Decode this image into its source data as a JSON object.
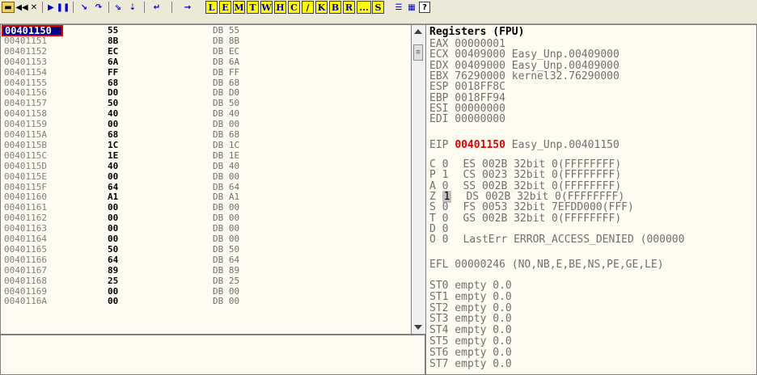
{
  "toolbar": {
    "letters": [
      "L",
      "E",
      "M",
      "T",
      "W",
      "H",
      "C",
      "/",
      "K",
      "B",
      "R",
      "...",
      "S"
    ],
    "help": "?"
  },
  "dump": {
    "selected_address": "00401150",
    "rows": [
      {
        "addr": "00401150",
        "hex": "55",
        "dis": "DB 55"
      },
      {
        "addr": "00401151",
        "hex": "8B",
        "dis": "DB 8B"
      },
      {
        "addr": "00401152",
        "hex": "EC",
        "dis": "DB EC"
      },
      {
        "addr": "00401153",
        "hex": "6A",
        "dis": "DB 6A"
      },
      {
        "addr": "00401154",
        "hex": "FF",
        "dis": "DB FF"
      },
      {
        "addr": "00401155",
        "hex": "68",
        "dis": "DB 68"
      },
      {
        "addr": "00401156",
        "hex": "D0",
        "dis": "DB D0"
      },
      {
        "addr": "00401157",
        "hex": "50",
        "dis": "DB 50"
      },
      {
        "addr": "00401158",
        "hex": "40",
        "dis": "DB 40"
      },
      {
        "addr": "00401159",
        "hex": "00",
        "dis": "DB 00"
      },
      {
        "addr": "0040115A",
        "hex": "68",
        "dis": "DB 68"
      },
      {
        "addr": "0040115B",
        "hex": "1C",
        "dis": "DB 1C"
      },
      {
        "addr": "0040115C",
        "hex": "1E",
        "dis": "DB 1E"
      },
      {
        "addr": "0040115D",
        "hex": "40",
        "dis": "DB 40"
      },
      {
        "addr": "0040115E",
        "hex": "00",
        "dis": "DB 00"
      },
      {
        "addr": "0040115F",
        "hex": "64",
        "dis": "DB 64"
      },
      {
        "addr": "00401160",
        "hex": "A1",
        "dis": "DB A1"
      },
      {
        "addr": "00401161",
        "hex": "00",
        "dis": "DB 00"
      },
      {
        "addr": "00401162",
        "hex": "00",
        "dis": "DB 00"
      },
      {
        "addr": "00401163",
        "hex": "00",
        "dis": "DB 00"
      },
      {
        "addr": "00401164",
        "hex": "00",
        "dis": "DB 00"
      },
      {
        "addr": "00401165",
        "hex": "50",
        "dis": "DB 50"
      },
      {
        "addr": "00401166",
        "hex": "64",
        "dis": "DB 64"
      },
      {
        "addr": "00401167",
        "hex": "89",
        "dis": "DB 89"
      },
      {
        "addr": "00401168",
        "hex": "25",
        "dis": "DB 25"
      },
      {
        "addr": "00401169",
        "hex": "00",
        "dis": "DB 00"
      },
      {
        "addr": "0040116A",
        "hex": "00",
        "dis": "DB 00"
      }
    ]
  },
  "registers": {
    "title": "Registers (FPU)",
    "gp": [
      "EAX 00000001",
      "ECX 00409000 Easy_Unp.00409000",
      "EDX 00409000 Easy_Unp.00409000",
      "EBX 76290000 kernel32.76290000",
      "ESP 0018FF8C",
      "EBP 0018FF94",
      "ESI 00000000",
      "EDI 00000000"
    ],
    "eip_label": "EIP",
    "eip_value": "00401150",
    "eip_symbol": "Easy_Unp.00401150",
    "flags": [
      {
        "flag": "C 0",
        "seg": "ES 002B 32bit 0(FFFFFFFF)"
      },
      {
        "flag": "P 1",
        "seg": "CS 0023 32bit 0(FFFFFFFF)"
      },
      {
        "flag": "A 0",
        "seg": "SS 002B 32bit 0(FFFFFFFF)"
      },
      {
        "flag": "Z",
        "flagval": "1",
        "seg": "DS 002B 32bit 0(FFFFFFFF)"
      },
      {
        "flag": "S 0",
        "seg": "FS 0053 32bit 7EFDD000(FFF)"
      },
      {
        "flag": "T 0",
        "seg": "GS 002B 32bit 0(FFFFFFFF)"
      },
      {
        "flag": "D 0",
        "seg": ""
      },
      {
        "flag": "O 0",
        "seg": "LastErr ERROR_ACCESS_DENIED (000000"
      }
    ],
    "efl": "EFL 00000246 (NO,NB,E,BE,NS,PE,GE,LE)",
    "fpu": [
      "ST0 empty 0.0",
      "ST1 empty 0.0",
      "ST2 empty 0.0",
      "ST3 empty 0.0",
      "ST4 empty 0.0",
      "ST5 empty 0.0",
      "ST6 empty 0.0",
      "ST7 empty 0.0"
    ]
  }
}
